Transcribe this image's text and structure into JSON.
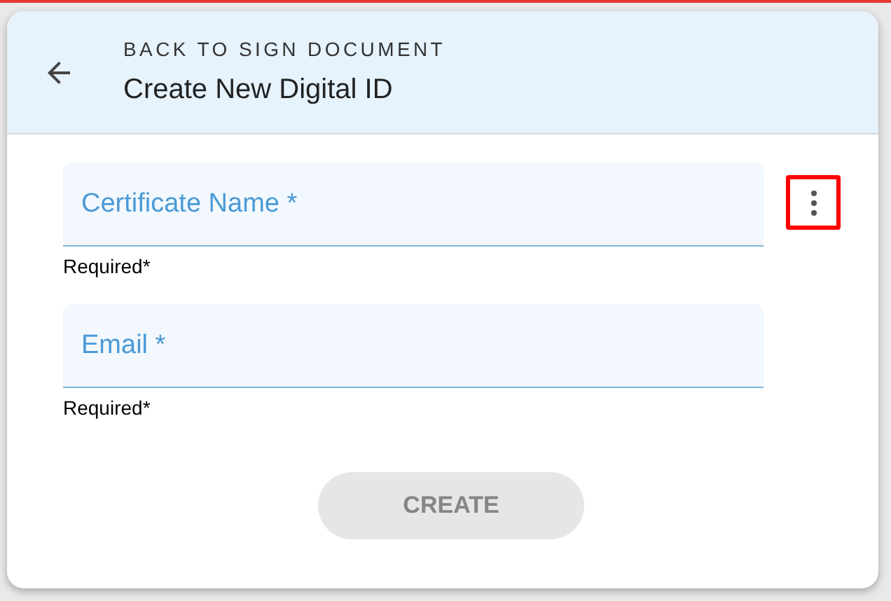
{
  "header": {
    "back_label": "BACK TO SIGN DOCUMENT",
    "title": "Create New Digital ID"
  },
  "fields": [
    {
      "placeholder": "Certificate Name *",
      "helper": "Required*"
    },
    {
      "placeholder": "Email *",
      "helper": "Required*"
    }
  ],
  "more_button": {
    "highlighted": true
  },
  "create_button": {
    "label": "CREATE",
    "disabled": true
  }
}
